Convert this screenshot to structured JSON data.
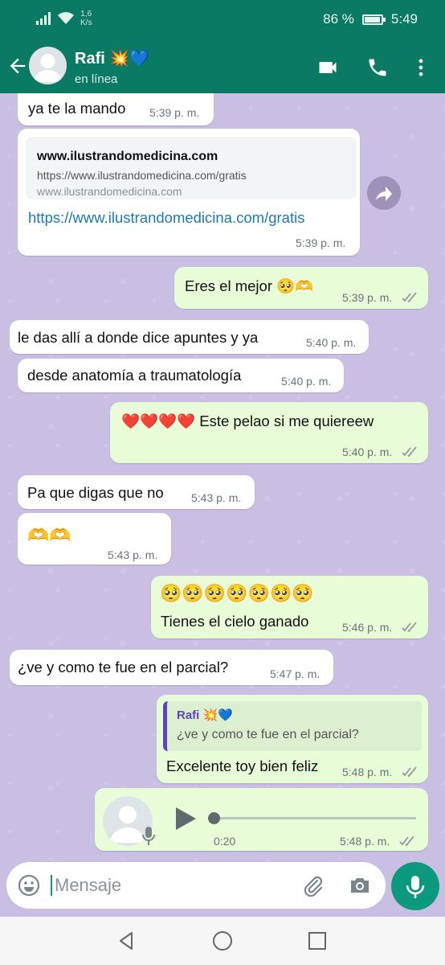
{
  "status_bar": {
    "net_speed_value": "1,6",
    "net_speed_unit": "K/s",
    "battery": "86 %",
    "battery_level": 0.86,
    "time": "5:49"
  },
  "header": {
    "contact_name": "Rafi 💥💙",
    "contact_status": "en línea",
    "icons": [
      "back-arrow-icon",
      "video-call-icon",
      "phone-icon",
      "more-vert-icon"
    ]
  },
  "messages": [
    {
      "dir": "in",
      "text": "ya te la mando",
      "time": "5:39 p. m."
    },
    {
      "dir": "in",
      "type": "link",
      "preview_title": "www.ilustrandomedicina.com",
      "preview_url": "https://www.ilustrandomedicina.com/gratis",
      "preview_domain": "www.ilustrandomedicina.com",
      "text": "https://www.ilustrandomedicina.com/gratis",
      "time": "5:39 p. m."
    },
    {
      "dir": "out",
      "text": "Eres el mejor 🥺🫶",
      "time": "5:39 p. m."
    },
    {
      "dir": "in",
      "text": "le das allí a donde dice apuntes y ya",
      "time": "5:40 p. m."
    },
    {
      "dir": "in",
      "text": "desde anatomía a traumatología",
      "time": "5:40 p. m."
    },
    {
      "dir": "out",
      "text": "❤️❤️❤️❤️ Este pelao si me quiereew",
      "time": "5:40 p. m."
    },
    {
      "dir": "in",
      "text": "Pa que digas que no",
      "time": "5:43 p. m."
    },
    {
      "dir": "in",
      "text": "🫶🫶",
      "time": "5:43 p. m."
    },
    {
      "dir": "out",
      "emoji_line": "🥺🥺🥺🥺🥺🥺🥺",
      "text": "Tienes el cielo ganado",
      "time": "5:46 p. m."
    },
    {
      "dir": "in",
      "text": "¿ve y como te fue en el parcial?",
      "time": "5:47 p. m."
    },
    {
      "dir": "out",
      "type": "reply",
      "quote_author": "Rafi 💥💙",
      "quote_text": "¿ve y como te fue en el parcial?",
      "text": "Excelente toy bien feliz",
      "time": "5:48 p. m."
    },
    {
      "dir": "out",
      "type": "voice",
      "duration": "0:20",
      "progress": 0,
      "time": "5:48 p. m."
    }
  ],
  "composer": {
    "placeholder": "Mensaje",
    "icons": [
      "emoji-icon",
      "attach-icon",
      "camera-icon",
      "mic-icon"
    ]
  },
  "nav": {
    "icons": [
      "back-triangle-icon",
      "home-circle-icon",
      "recents-square-icon"
    ]
  },
  "colors": {
    "header": "#0b7a64",
    "outgoing": "#e7fcd7",
    "incoming": "#ffffff",
    "wallpaper": "#c9bfe3",
    "accent": "#0b9a7e"
  }
}
